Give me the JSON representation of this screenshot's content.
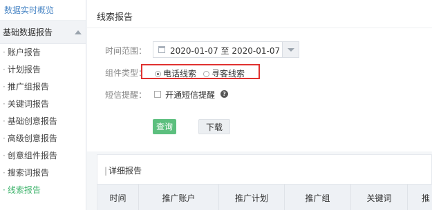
{
  "sidebar": {
    "top_link": "数据实时概览",
    "section": "基础数据报告",
    "bullet": "·",
    "items": [
      {
        "label": "账户报告",
        "active": false
      },
      {
        "label": "计划报告",
        "active": false
      },
      {
        "label": "推广组报告",
        "active": false
      },
      {
        "label": "关键词报告",
        "active": false
      },
      {
        "label": "基础创意报告",
        "active": false
      },
      {
        "label": "高级创意报告",
        "active": false
      },
      {
        "label": "创意组件报告",
        "active": false
      },
      {
        "label": "搜索词报告",
        "active": false
      },
      {
        "label": "线索报告",
        "active": true
      }
    ]
  },
  "main": {
    "title": "线索报告",
    "time_range_label": "时间范围：",
    "date_range_value": "2020-01-07 至 2020-01-07",
    "component_type_label": "组件类型：",
    "radio_phone": "电话线索",
    "radio_search": "寻客线索",
    "sms_label": "短信提醒：",
    "sms_checkbox_label": "开通短信提醒",
    "help_icon_text": "?",
    "query_button": "查询",
    "download_button": "下载"
  },
  "detail": {
    "bar": "|",
    "title": "详细报告",
    "columns": [
      "时间",
      "推广账户",
      "推广计划",
      "推广组",
      "关键词",
      "推"
    ]
  },
  "colors": {
    "accent_green": "#5cbf7e",
    "active_link": "#3db36b",
    "highlight_box": "#e0312f",
    "link_blue": "#4a86c5"
  },
  "icons": [
    "calendar-icon",
    "dropdown-arrow-icon",
    "collapse-caret-icon",
    "help-icon"
  ]
}
